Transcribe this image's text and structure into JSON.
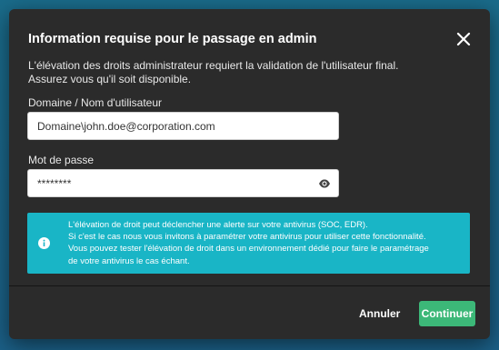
{
  "dialog": {
    "title": "Information requise pour le passage en admin",
    "description_lines": [
      "L'élévation des droits administrateur requiert la validation de l'utilisateur final.",
      "Assurez vous qu'il soit disponible."
    ],
    "close_icon": "close-icon"
  },
  "form": {
    "username_label": "Domaine / Nom d'utilisateur",
    "username_value": "Domaine\\john.doe@corporation.com",
    "password_label": "Mot de passe",
    "password_value": "********",
    "password_toggle_icon": "eye-icon"
  },
  "alert": {
    "icon": "info-icon",
    "color": "#19b5c6",
    "lines": [
      "L'élévation de droit peut déclencher une alerte sur votre antivirus (SOC, EDR).",
      "Si c'est le cas nous vous invitons à paramétrer votre antivirus pour utiliser cette fonctionnalité.",
      "Vous pouvez tester l'élévation de droit  dans un environnement dédié pour faire le paramétrage",
      "de votre antivirus le cas échant."
    ]
  },
  "footer": {
    "cancel_label": "Annuler",
    "continue_label": "Continuer",
    "continue_color": "#3cb878"
  }
}
